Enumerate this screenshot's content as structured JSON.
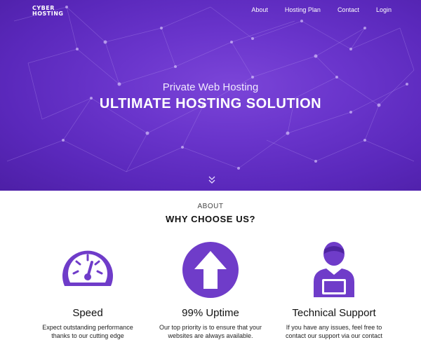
{
  "brand": {
    "line1": "CYBER",
    "line2": "HOSTING"
  },
  "nav": {
    "about": "About",
    "hosting_plan": "Hosting Plan",
    "contact": "Contact",
    "login": "Login"
  },
  "hero": {
    "subtitle": "Private Web Hosting",
    "title": "ULTIMATE HOSTING SOLUTION"
  },
  "about": {
    "eyebrow": "ABOUT",
    "title": "WHY CHOOSE US?"
  },
  "features": [
    {
      "icon": "speedometer-icon",
      "title": "Speed",
      "text_line1": "Expect outstanding performance",
      "text_line2": "thanks to our cutting edge"
    },
    {
      "icon": "up-arrow-icon",
      "title": "99% Uptime",
      "text_line1": "Our top priority is to ensure that your",
      "text_line2": "websites are always available."
    },
    {
      "icon": "support-person-icon",
      "title": "Technical Support",
      "text_line1": "If you have any issues, feel free to",
      "text_line2": "contact our support via our contact"
    }
  ],
  "colors": {
    "accent": "#6f3cc9",
    "hero_dark": "#4d1fa6",
    "hero_light": "#7b45d8"
  }
}
